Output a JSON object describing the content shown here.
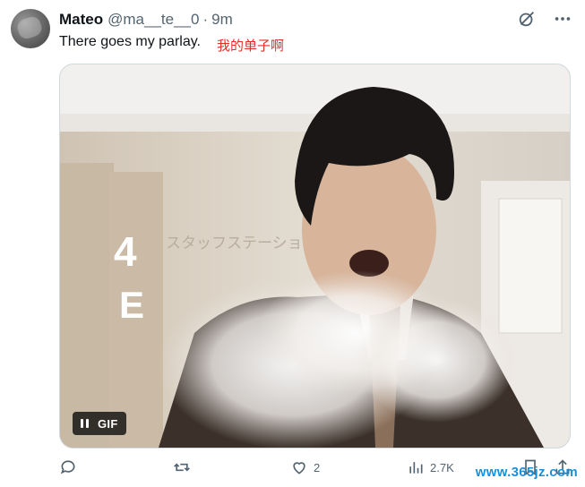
{
  "tweet": {
    "display_name": "Mateo",
    "handle": "@ma__te__0",
    "separator": "·",
    "time": "9m",
    "text": "There goes my parlay.",
    "annotation": "我的单子啊"
  },
  "media": {
    "gif_label": "GIF",
    "scene_signage": {
      "number": "4",
      "letter": "E",
      "jp": "スタッフステーショ"
    }
  },
  "actions": {
    "reply_count": "",
    "retweet_count": "",
    "like_count": "2",
    "views_count": "2.7K"
  },
  "watermark": "www.365jz.com",
  "colors": {
    "text": "#0f1419",
    "muted": "#536471",
    "annotation": "#e0302a",
    "watermark": "#1a8fd6"
  }
}
